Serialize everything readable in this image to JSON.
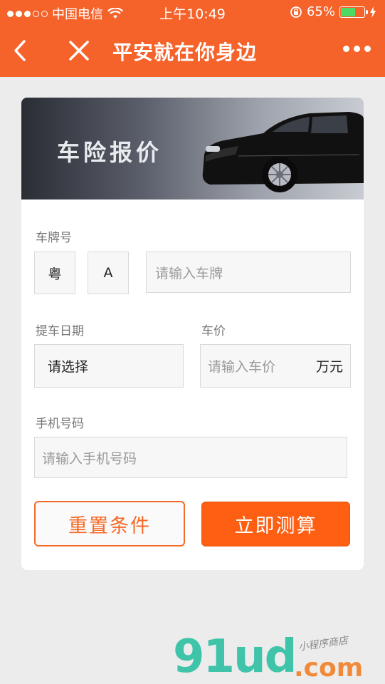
{
  "status_bar": {
    "carrier": "中国电信",
    "time": "上午10:49",
    "battery_percent": "65%",
    "battery_level": 0.65,
    "signal_dots_filled": 3,
    "signal_dots_total": 5
  },
  "nav": {
    "title": "平安就在你身边",
    "back_icon": "chevron-left-icon",
    "close_icon": "close-icon",
    "more_icon": "more-dots-icon"
  },
  "banner": {
    "text": "车险报价"
  },
  "form": {
    "plate_label": "车牌号",
    "plate_province": "粤",
    "plate_letter": "A",
    "plate_placeholder": "请输入车牌",
    "date_label": "提车日期",
    "date_value": "请选择",
    "price_label": "车价",
    "price_placeholder": "请输入车价",
    "price_unit": "万元",
    "phone_label": "手机号码",
    "phone_placeholder": "请输入手机号码"
  },
  "buttons": {
    "reset": "重置条件",
    "calculate": "立即测算"
  },
  "watermark": {
    "main": "91ud",
    "domain": ".com",
    "tagline": "小程序商店"
  },
  "colors": {
    "brand": "#f5622a",
    "button_primary": "#fe5f12"
  }
}
